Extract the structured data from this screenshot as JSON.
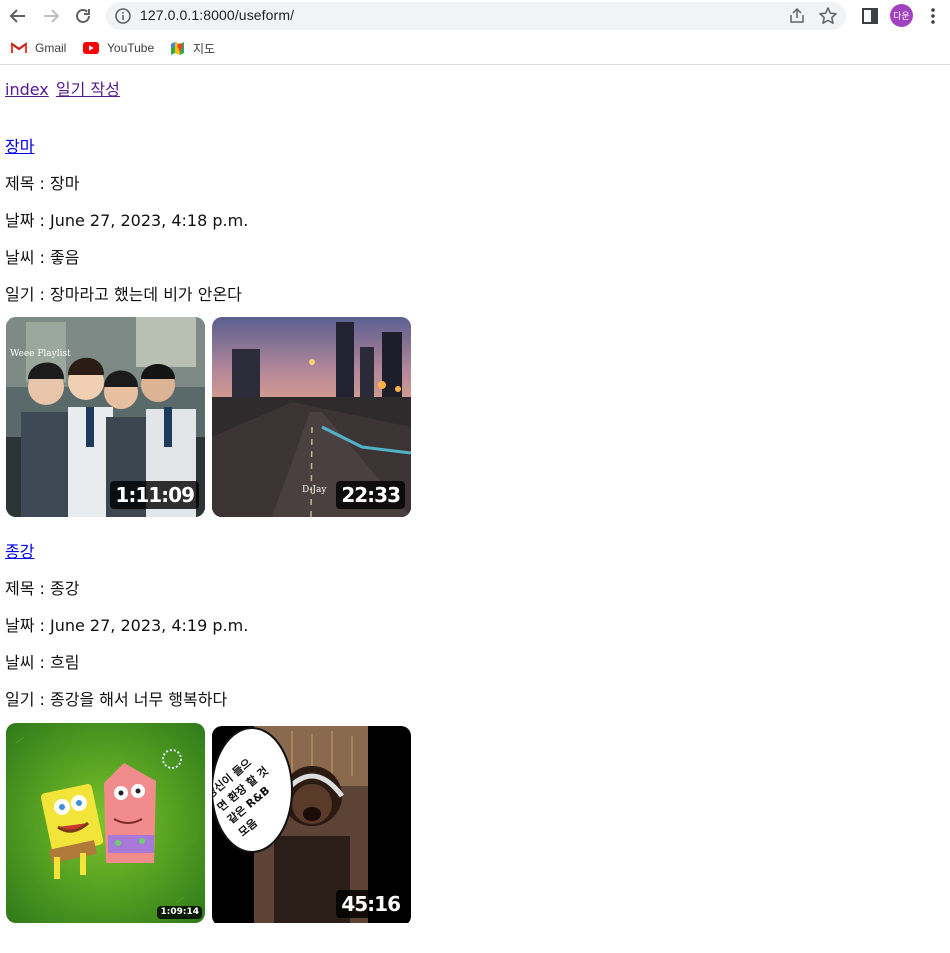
{
  "browser": {
    "url": "127.0.0.1:8000/useform/",
    "avatar_text": "다운",
    "bookmarks": [
      {
        "label": "Gmail",
        "icon": "gmail-icon"
      },
      {
        "label": "YouTube",
        "icon": "youtube-icon"
      },
      {
        "label": "지도",
        "icon": "maps-icon"
      }
    ]
  },
  "nav": {
    "index_label": "index",
    "write_label": "일기 작성"
  },
  "entries": [
    {
      "link": "장마",
      "title": "제목 : 장마",
      "date": "날짜 : June 27, 2023, 4:18 p.m.",
      "weather": "날씨 : 좋음",
      "diary": "일기 : 장마라고 했는데 비가 안온다",
      "videos": [
        {
          "duration": "1:11:09",
          "caption": "Weee Playlist"
        },
        {
          "duration": "22:33",
          "caption": "D-Jay"
        }
      ]
    },
    {
      "link": "종강",
      "title": "제목 : 종강",
      "date": "날짜 : June 27, 2023, 4:19 p.m.",
      "weather": "날씨 : 흐림",
      "diary": "일기 : 종강을 해서 너무 행복하다",
      "videos": [
        {
          "duration": "1:09:14",
          "caption": ""
        },
        {
          "duration": "45:16",
          "caption": "당신이 들으면 환장 할 것 같은 R&B 모음"
        }
      ]
    }
  ]
}
